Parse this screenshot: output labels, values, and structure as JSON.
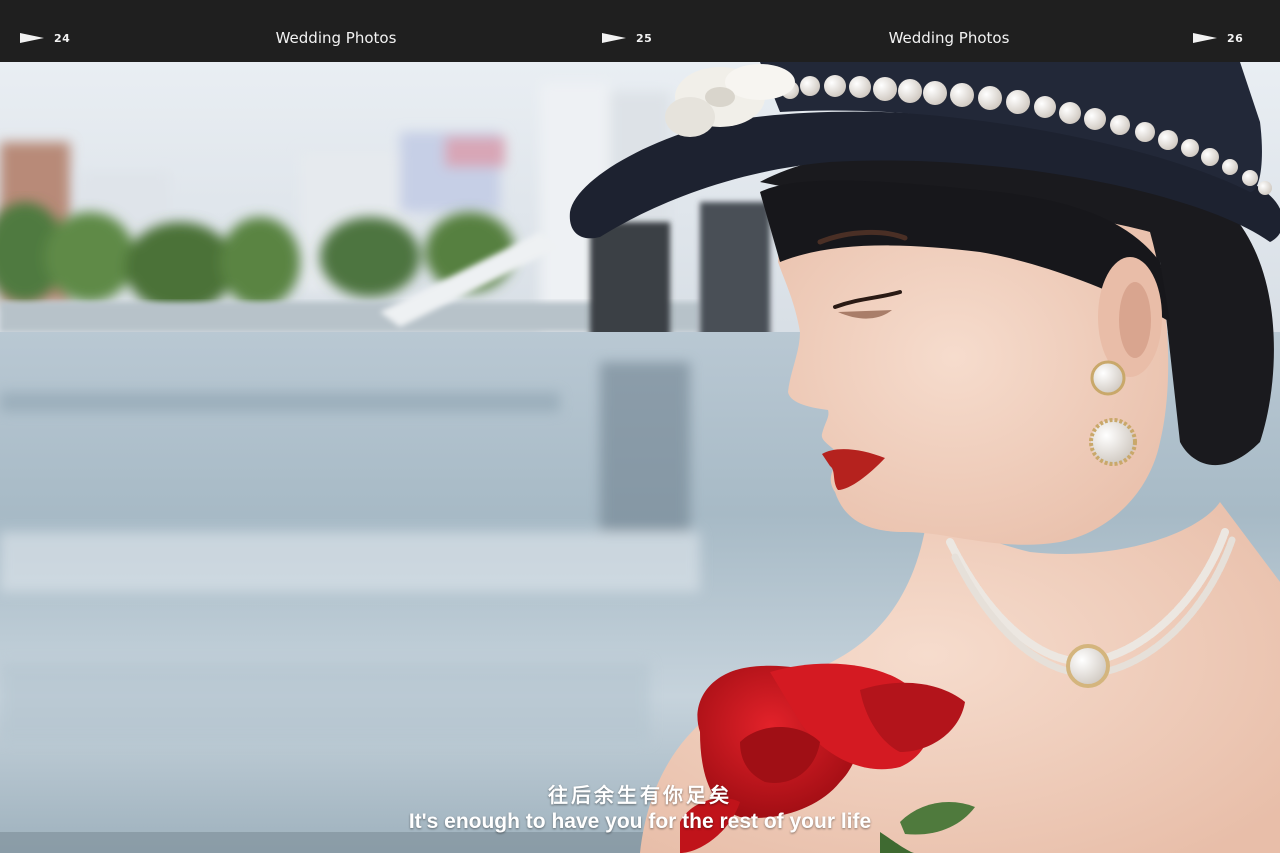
{
  "film_strip": {
    "frames": [
      {
        "number": "24",
        "title": "Wedding Photos"
      },
      {
        "number": "25",
        "title": "Wedding Photos"
      },
      {
        "number": "26"
      }
    ]
  },
  "subtitle": {
    "chinese": "往后余生有你足矣",
    "english": "It's enough to have you for the rest of your life"
  },
  "colors": {
    "bar_background": "#1f1f1f",
    "text": "#f2f2f2",
    "lip": "#b5221e",
    "rose": "#c8141a",
    "hat": "#1d2230"
  }
}
